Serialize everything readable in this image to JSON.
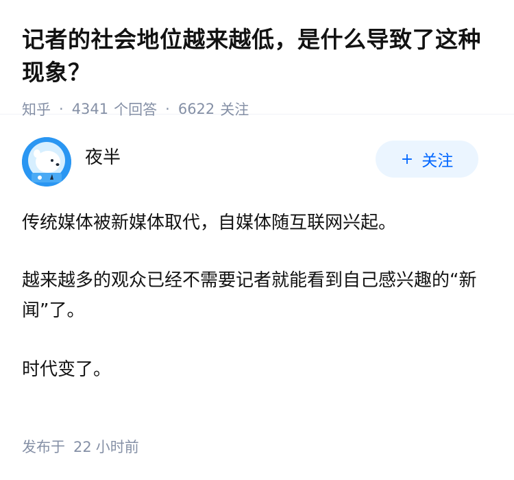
{
  "question": {
    "title": "记者的社会地位越来越低，是什么导致了这种现象？",
    "source": "知乎",
    "answer_count": "4341",
    "answer_label": "个回答",
    "follow_count": "6622",
    "follow_label": "关注"
  },
  "answer": {
    "author_name": "夜半",
    "follow_button": {
      "icon": "plus-icon",
      "label": "关注"
    },
    "paragraphs": [
      "传统媒体被新媒体取代，自媒体随互联网兴起。",
      "越来越多的观众已经不需要记者就能看到自己感兴趣的“新闻”了。",
      "时代变了。"
    ],
    "published_prefix": "发布于",
    "published_value": "22",
    "published_unit": "小时前"
  },
  "colors": {
    "meta_gray": "#8590a6",
    "brand_blue": "#0066ff",
    "button_bg": "#ebf5ff",
    "avatar_blue": "#1f8ff0"
  }
}
